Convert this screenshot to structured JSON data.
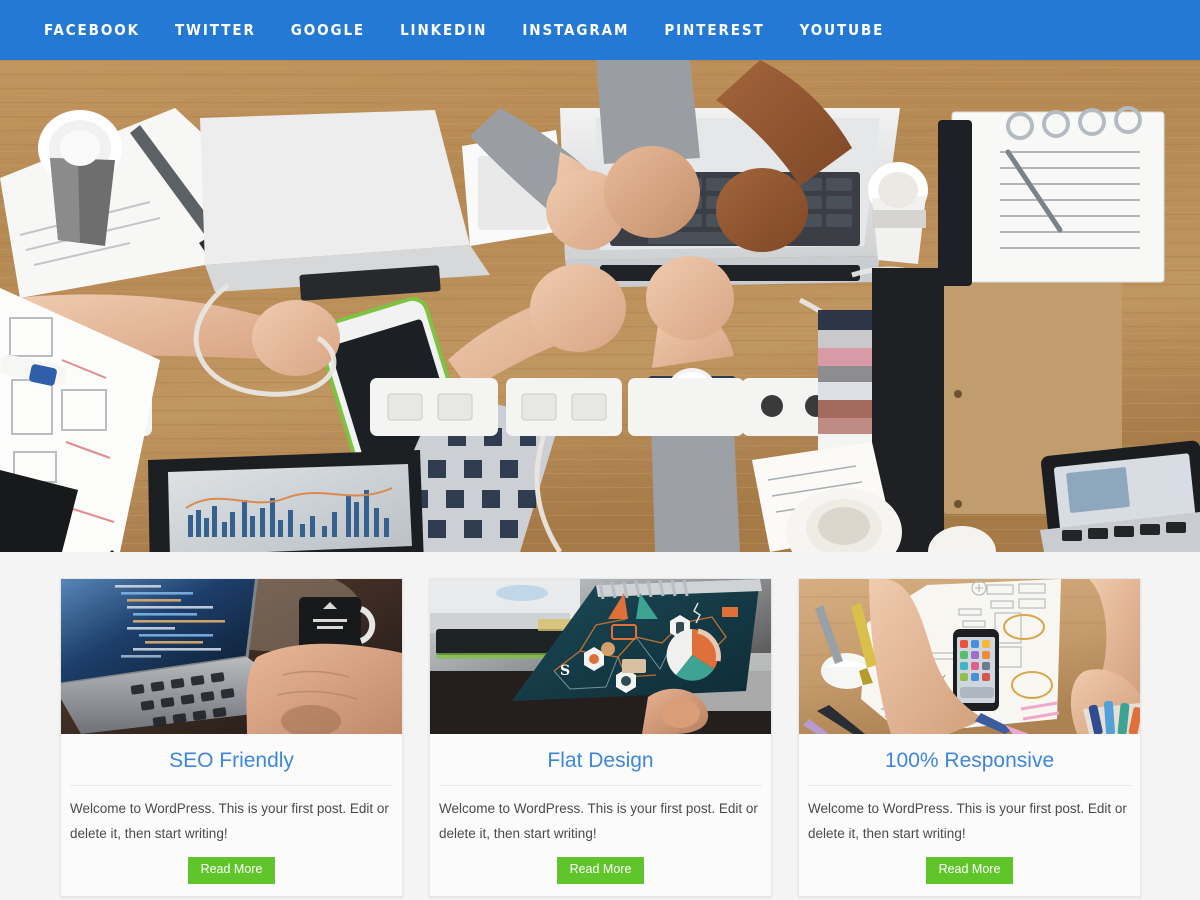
{
  "theme": {
    "nav_bg": "#2379d3",
    "page_bg": "#f4f4f4",
    "title_color": "#3d87db",
    "button_color": "#5fc52b",
    "text_color": "#4a4a4a"
  },
  "navbar": {
    "items": [
      {
        "label": "Facebook",
        "name": "nav-item-facebook"
      },
      {
        "label": "Twitter",
        "name": "nav-item-twitter"
      },
      {
        "label": "Google",
        "name": "nav-item-google"
      },
      {
        "label": "LinkedIn",
        "name": "nav-item-linkedin"
      },
      {
        "label": "Instagram",
        "name": "nav-item-instagram"
      },
      {
        "label": "Pinterest",
        "name": "nav-item-pinterest"
      },
      {
        "label": "YouTube",
        "name": "nav-item-youtube"
      }
    ]
  },
  "hero": {
    "alt": "Team fist bump over a wooden desk covered with laptops, notebooks, coffee cups, power strips and a tablet"
  },
  "cards": [
    {
      "title": "SEO Friendly",
      "excerpt": "Welcome to WordPress. This is your first post. Edit or delete it, then start writing!",
      "button": "Read More",
      "image_alt": "Hands typing on a laptop showing code on a dark blue screen next to a black mug"
    },
    {
      "title": "Flat Design",
      "excerpt": "Welcome to WordPress. This is your first post. Edit or delete it, then start writing!",
      "button": "Read More",
      "image_alt": "Hand holding a teal spiral notebook printed with an orange and teal infographic"
    },
    {
      "title": "100% Responsive",
      "excerpt": "Welcome to WordPress. This is your first post. Edit or delete it, then start writing!",
      "button": "Read More",
      "image_alt": "Designer sketching mobile app wireframes on paper with a smartphone, mouse and pens"
    }
  ]
}
